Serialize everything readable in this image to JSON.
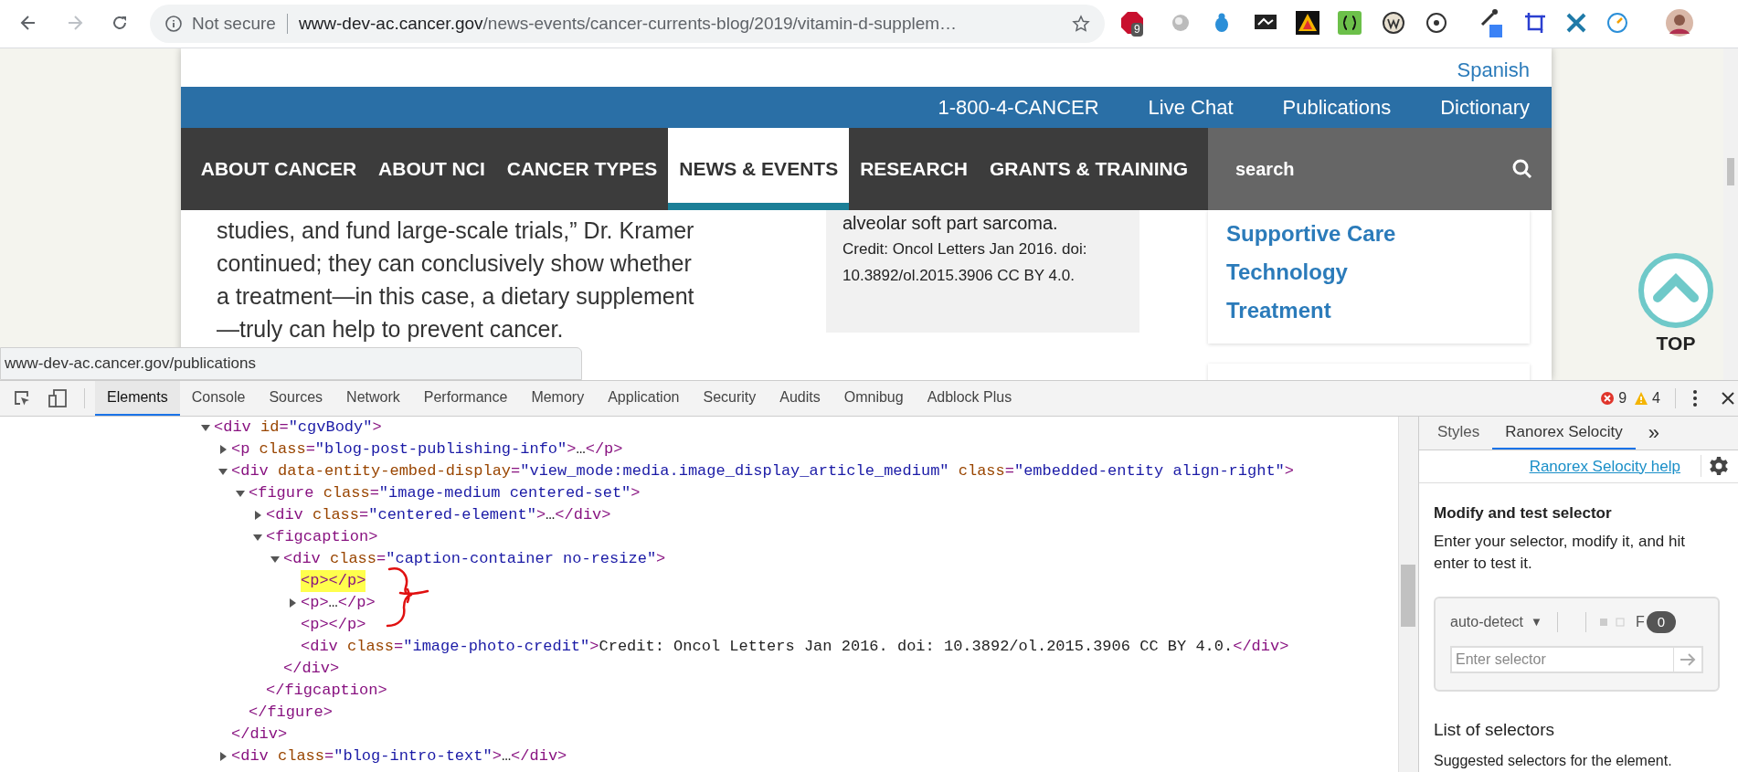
{
  "browser": {
    "security": "Not secure",
    "url_host": "www-dev-ac.cancer.gov",
    "url_path": "/news-events/cancer-currents-blog/2019/vitamin-d-supplem…",
    "extension_badge": "9"
  },
  "site": {
    "language_link": "Spanish",
    "utility_links": [
      "1-800-4-CANCER",
      "Live Chat",
      "Publications",
      "Dictionary"
    ],
    "nav": [
      {
        "label": "ABOUT CANCER",
        "selected": false
      },
      {
        "label": "ABOUT NCI",
        "selected": false
      },
      {
        "label": "CANCER TYPES",
        "selected": false
      },
      {
        "label": "NEWS & EVENTS",
        "selected": true
      },
      {
        "label": "RESEARCH",
        "selected": false
      },
      {
        "label": "GRANTS & TRAINING",
        "selected": false
      }
    ],
    "search": {
      "placeholder": "search"
    }
  },
  "article": {
    "paragraph_lines": [
      "studies, and fund large-scale trials,” Dr. Kramer",
      "continued; they can conclusively show whether",
      "a treatment—in this case, a dietary supplement",
      "—truly can help to prevent cancer."
    ],
    "caption_title": "alveolar soft part sarcoma.",
    "caption_credit": "Credit: Oncol Letters Jan 2016. doi: 10.3892/ol.2015.3906 CC BY 4.0.",
    "topic_links": [
      "Supportive Care",
      "Technology",
      "Treatment"
    ],
    "top_button": "TOP"
  },
  "status_url": "www-dev-ac.cancer.gov/publications",
  "devtools": {
    "tabs": [
      {
        "label": "Elements",
        "selected": true
      },
      {
        "label": "Console",
        "selected": false
      },
      {
        "label": "Sources",
        "selected": false
      },
      {
        "label": "Network",
        "selected": false
      },
      {
        "label": "Performance",
        "selected": false
      },
      {
        "label": "Memory",
        "selected": false
      },
      {
        "label": "Application",
        "selected": false
      },
      {
        "label": "Security",
        "selected": false
      },
      {
        "label": "Audits",
        "selected": false
      },
      {
        "label": "Omnibug",
        "selected": false
      },
      {
        "label": "Adblock Plus",
        "selected": false
      }
    ],
    "errors": "9",
    "warnings": "4",
    "dom_tree": {
      "open": "<div id=\"cgvBody\">",
      "expanded": true,
      "highlighted": false,
      "children": [
        {
          "open": "<p class=\"blog-post-publishing-info\">…</p>",
          "expanded": false,
          "highlighted": false
        },
        {
          "open": "<div data-entity-embed-display=\"view_mode:media.image_display_article_medium\" class=\"embedded-entity align-right\">",
          "expanded": true,
          "highlighted": false,
          "close": "</div>",
          "children": [
            {
              "open": "<figure class=\"image-medium centered-set\">",
              "expanded": true,
              "highlighted": false,
              "close": "</figure>",
              "children": [
                {
                  "open": "<div class=\"centered-element\">…</div>",
                  "expanded": false,
                  "highlighted": false
                },
                {
                  "open": "<figcaption>",
                  "expanded": true,
                  "highlighted": false,
                  "close": "</figcaption>",
                  "children": [
                    {
                      "open": "<div class=\"caption-container no-resize\">",
                      "expanded": true,
                      "highlighted": false,
                      "close": "</div>",
                      "children": [
                        {
                          "open": "<p></p>",
                          "highlighted": true
                        },
                        {
                          "open": "<p>…</p>",
                          "expanded": false,
                          "highlighted": false
                        },
                        {
                          "open": "<p></p>",
                          "highlighted": false
                        },
                        {
                          "open": "<div class=\"image-photo-credit\">Credit: Oncol Letters Jan 2016. doi: 10.3892/ol.2015.3906 CC BY 4.0.</div>",
                          "highlighted": false
                        }
                      ]
                    }
                  ]
                }
              ]
            }
          ]
        },
        {
          "open": "<div class=\"blog-intro-text\">…</div>",
          "expanded": false,
          "highlighted": false
        }
      ]
    },
    "sidebar": {
      "tabs": [
        {
          "label": "Styles",
          "selected": false
        },
        {
          "label": "Ranorex Selocity",
          "selected": true
        }
      ],
      "more": "»",
      "help_link": "Ranorex Selocity help",
      "heading": "Modify and test selector",
      "description": "Enter your selector, modify it, and hit enter to test it.",
      "mode": "auto-detect",
      "mode_caret": "▼",
      "cut_label": "F",
      "count": "0",
      "selector": {
        "placeholder": "Enter selector"
      },
      "list_heading": "List of selectors",
      "list_description": "Suggested selectors for the element."
    }
  }
}
